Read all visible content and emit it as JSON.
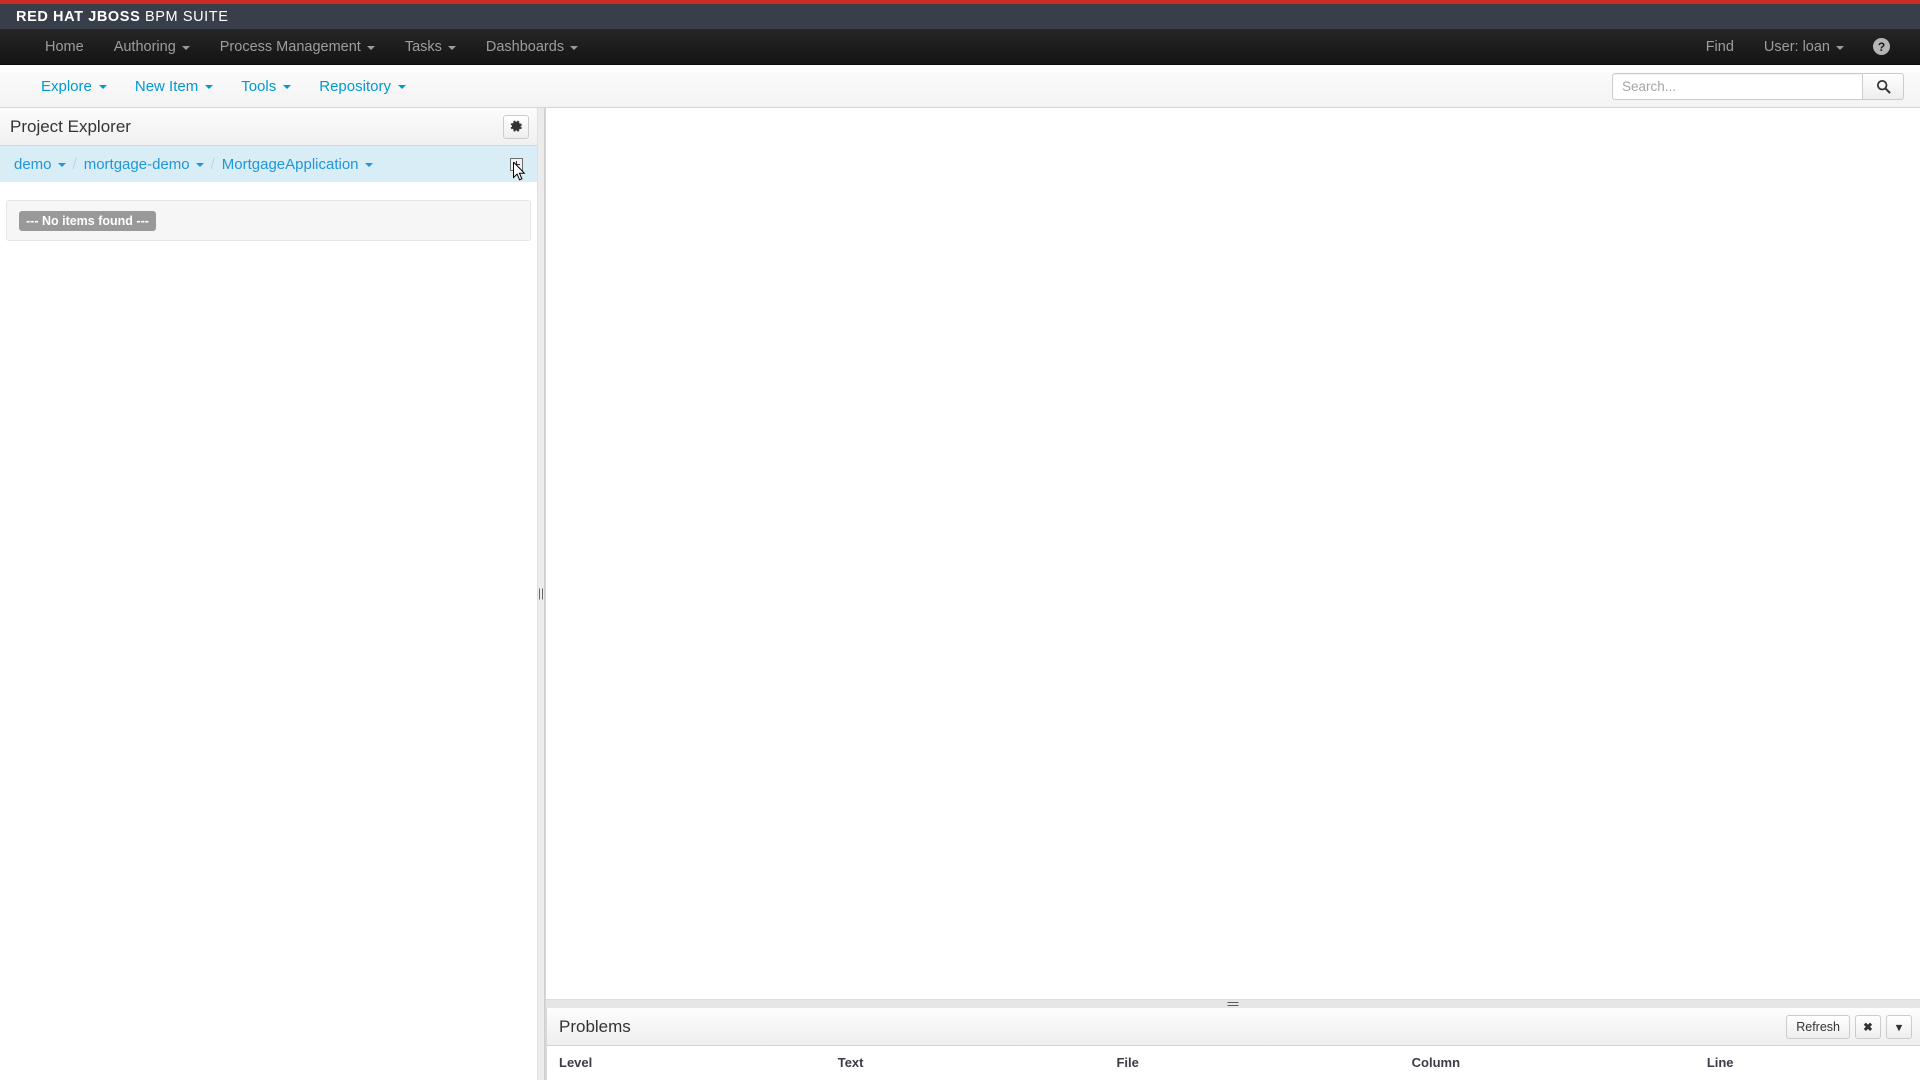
{
  "brand": {
    "bold_text": "RED HAT JBOSS",
    "light_text": " BPM SUITE"
  },
  "nav": {
    "items": [
      {
        "label": "Home",
        "has_caret": false
      },
      {
        "label": "Authoring",
        "has_caret": true
      },
      {
        "label": "Process Management",
        "has_caret": true
      },
      {
        "label": "Tasks",
        "has_caret": true
      },
      {
        "label": "Dashboards",
        "has_caret": true
      }
    ],
    "right": {
      "find_label": "Find",
      "user_label": "User: loan",
      "help_icon": "question-circle-icon",
      "help_glyph": "?"
    }
  },
  "toolbar": {
    "items": [
      {
        "label": "Explore",
        "has_caret": true
      },
      {
        "label": "New Item",
        "has_caret": true
      },
      {
        "label": "Tools",
        "has_caret": true
      },
      {
        "label": "Repository",
        "has_caret": true
      }
    ],
    "search": {
      "placeholder": "Search...",
      "value": "",
      "button_icon": "search-icon"
    }
  },
  "project_explorer": {
    "title": "Project Explorer",
    "settings_icon": "gear-icon",
    "breadcrumb": {
      "separator": "/",
      "items": [
        {
          "label": "demo"
        },
        {
          "label": "mortgage-demo"
        },
        {
          "label": "MortgageApplication"
        }
      ],
      "expand_icon": "expand-plus-icon"
    },
    "empty_message": "--- No items found ---"
  },
  "problems": {
    "title": "Problems",
    "actions": {
      "refresh_label": "Refresh",
      "close_label": "✖",
      "menu_label": "▾"
    },
    "columns": [
      "Level",
      "Text",
      "File",
      "Column",
      "Line"
    ],
    "rows": []
  },
  "colors": {
    "brand_red": "#cc2b24",
    "brand_bar": "#393f4a",
    "nav_bar": "#1b1b1b",
    "link_blue": "#0099d3",
    "breadcrumb_bg": "#d9edf7",
    "badge_gray": "#999999"
  }
}
